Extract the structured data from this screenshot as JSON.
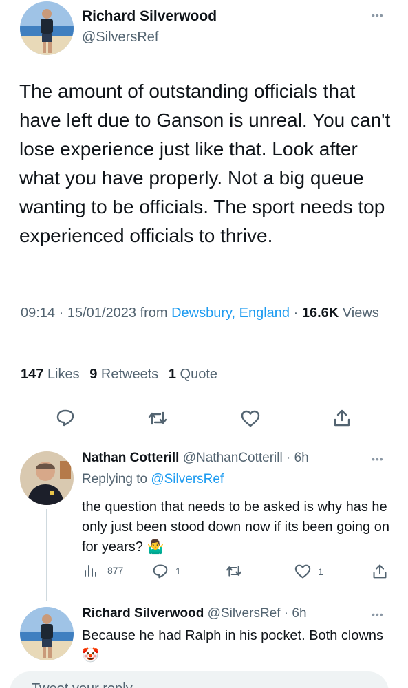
{
  "main_tweet": {
    "name": "Richard Silverwood",
    "handle": "@SilversRef",
    "text": "The amount of outstanding officials that have left due to Ganson is unreal. You can't lose experience just like that. Look after what you have properly. Not a big queue wanting to be officials. The sport needs top experienced officials to thrive.",
    "time": "09:14",
    "date": "15/01/2023",
    "from_label": "from",
    "location": "Dewsbury, England",
    "views_count": "16.6K",
    "views_label": "Views",
    "likes_count": "147",
    "likes_label": "Likes",
    "retweets_count": "9",
    "retweets_label": "Retweets",
    "quotes_count": "1",
    "quotes_label": "Quote"
  },
  "replies": [
    {
      "name": "Nathan Cotterill",
      "handle": "@NathanCotterill",
      "age": "6h",
      "replying_prefix": "Replying to",
      "replying_to": "@SilversRef",
      "text": "the question that needs to  be asked is why has he only just been stood down now if its been going on for years? 🤷‍♂️",
      "views": "877",
      "replies": "1",
      "likes": "1"
    },
    {
      "name": "Richard Silverwood",
      "handle": "@SilversRef",
      "age": "6h",
      "text": "Because he had Ralph in his pocket. Both clowns 🤡"
    }
  ],
  "reply_box": {
    "placeholder": "Tweet your reply"
  },
  "colors": {
    "accent": "#1d9bf0",
    "secondary_text": "#536471",
    "divider": "#e6ecf0"
  }
}
